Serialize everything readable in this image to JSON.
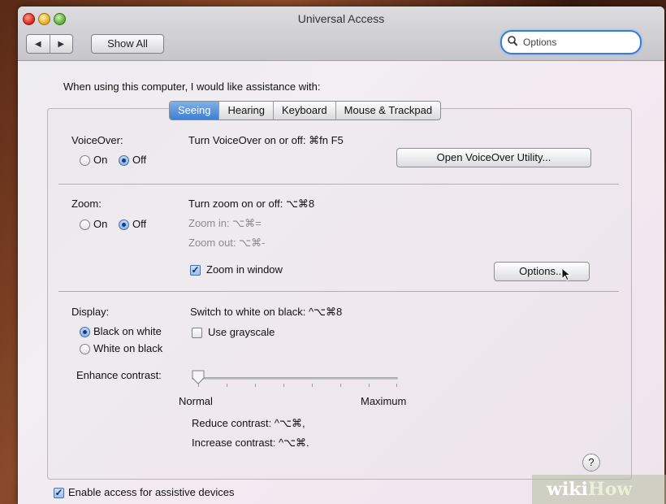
{
  "window": {
    "title": "Universal Access",
    "show_all_label": "Show All",
    "back_glyph": "◀",
    "forward_glyph": "▶",
    "search_value": "Options"
  },
  "intro_text": "When using this computer, I would like assistance with:",
  "tabs": [
    {
      "label": "Seeing",
      "active": true
    },
    {
      "label": "Hearing",
      "active": false
    },
    {
      "label": "Keyboard",
      "active": false
    },
    {
      "label": "Mouse & Trackpad",
      "active": false
    }
  ],
  "voiceover": {
    "label": "VoiceOver:",
    "on_label": "On",
    "off_label": "Off",
    "selected": "Off",
    "shortcut": "Turn VoiceOver on or off: ⌘fn F5",
    "utility_button": "Open VoiceOver Utility..."
  },
  "zoom": {
    "label": "Zoom:",
    "on_label": "On",
    "off_label": "Off",
    "selected": "Off",
    "shortcut": "Turn zoom on or off: ⌥⌘8",
    "zoom_in": "Zoom in: ⌥⌘=",
    "zoom_out": "Zoom out: ⌥⌘-",
    "zoom_in_window_label": "Zoom in window",
    "zoom_in_window_checked": true,
    "options_button": "Options..."
  },
  "display": {
    "label": "Display:",
    "black_on_white": "Black on white",
    "white_on_black": "White on black",
    "selected": "Black on white",
    "shortcut": "Switch to white on black: ^⌥⌘8",
    "grayscale_label": "Use grayscale",
    "grayscale_checked": false,
    "enhance_contrast_label": "Enhance contrast:",
    "contrast_value": 0,
    "normal_label": "Normal",
    "maximum_label": "Maximum",
    "reduce_contrast": "Reduce contrast: ^⌥⌘,",
    "increase_contrast": "Increase contrast: ^⌥⌘."
  },
  "help_label": "?",
  "assistive": {
    "label": "Enable access for assistive devices",
    "checked": true
  },
  "watermark": {
    "part1": "wiki",
    "part2": "How"
  }
}
